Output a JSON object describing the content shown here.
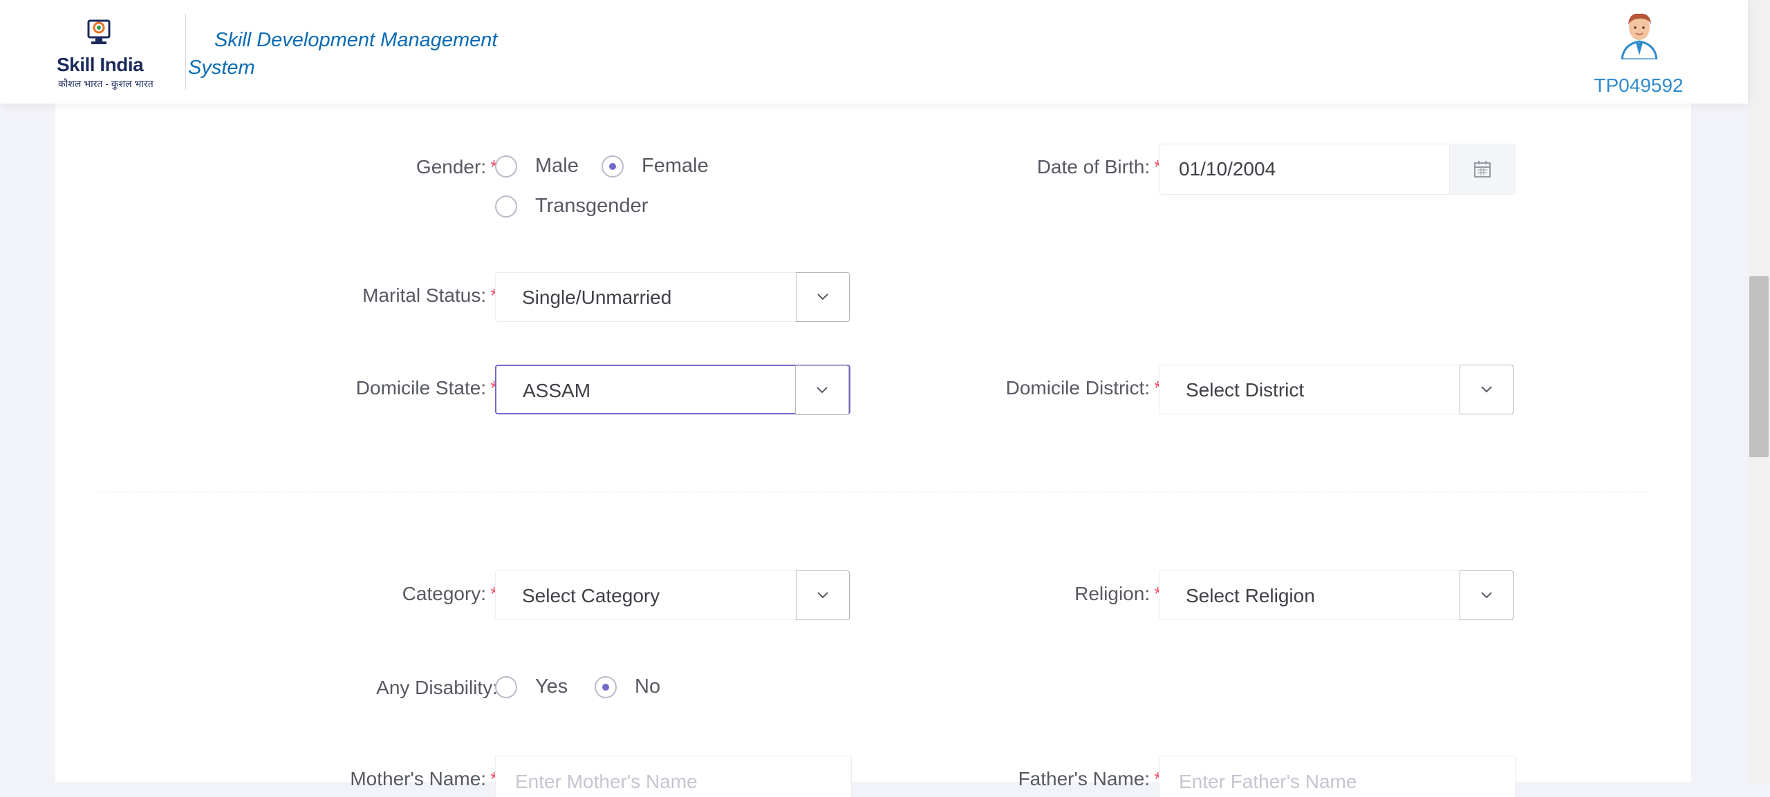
{
  "header": {
    "logo_text": "Skill India",
    "logo_subtext": "कौशल भारत - कुशल भारत",
    "app_title_line1": "Skill Development Management",
    "app_title_line2": "System",
    "user_id": "TP049592"
  },
  "form": {
    "gender": {
      "label": "Gender:",
      "required": "*",
      "options": [
        "Male",
        "Female",
        "Transgender"
      ],
      "selected": "Female"
    },
    "dob": {
      "label": "Date of Birth:",
      "required": "*",
      "value": "01/10/2004"
    },
    "marital_status": {
      "label": "Marital Status:",
      "required": "*",
      "value": "Single/Unmarried"
    },
    "domicile_state": {
      "label": "Domicile State:",
      "required": "*",
      "value": "ASSAM"
    },
    "domicile_district": {
      "label": "Domicile District:",
      "required": "*",
      "value": "Select District"
    },
    "category": {
      "label": "Category:",
      "required": "*",
      "value": "Select Category"
    },
    "religion": {
      "label": "Religion:",
      "required": "*",
      "value": "Select Religion"
    },
    "disability": {
      "label": "Any Disability:",
      "options": [
        "Yes",
        "No"
      ],
      "selected": "No"
    },
    "mother_name": {
      "label": "Mother's Name:",
      "required": "*",
      "placeholder": "Enter Mother's Name"
    },
    "father_name": {
      "label": "Father's Name:",
      "required": "*",
      "placeholder": "Enter Father's Name"
    }
  },
  "colors": {
    "accent": "#716aca",
    "required": "#f4516c",
    "brand_blue": "#0a6bb5",
    "user_id": "#2f8bcc"
  },
  "icons": {
    "caret": "chevron-down-icon",
    "calendar": "calendar-icon",
    "avatar": "user-avatar-icon"
  }
}
